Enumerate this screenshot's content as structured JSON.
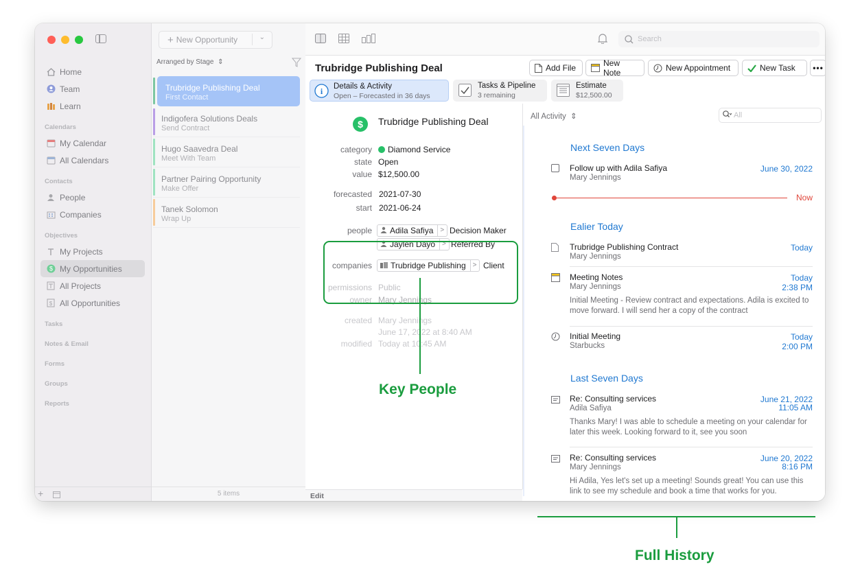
{
  "sidebar": {
    "nav": [
      {
        "label": "Home",
        "icon": "home-icon"
      },
      {
        "label": "Team",
        "icon": "team-icon"
      },
      {
        "label": "Learn",
        "icon": "learn-icon"
      }
    ],
    "sections": [
      {
        "header": "Calendars",
        "items": [
          {
            "label": "My Calendar",
            "icon": "calendar-icon"
          },
          {
            "label": "All Calendars",
            "icon": "calendars-icon"
          }
        ]
      },
      {
        "header": "Contacts",
        "items": [
          {
            "label": "People",
            "icon": "person-icon"
          },
          {
            "label": "Companies",
            "icon": "building-icon"
          }
        ]
      },
      {
        "header": "Objectives",
        "items": [
          {
            "label": "My Projects",
            "icon": "project-icon"
          },
          {
            "label": "My Opportunities",
            "icon": "opportunity-icon",
            "active": true
          },
          {
            "label": "All Projects",
            "icon": "projects-icon"
          },
          {
            "label": "All Opportunities",
            "icon": "opportunities-icon"
          }
        ]
      }
    ],
    "more_headers": [
      "Tasks",
      "Notes & Email",
      "Forms",
      "Groups",
      "Reports"
    ]
  },
  "list": {
    "new_button": "New Opportunity",
    "arranged_by": "Arranged by Stage",
    "footer": "5 items",
    "deals": [
      {
        "title": "Trubridge Publishing Deal",
        "subtitle": "First Contact",
        "color": "#7cc7a1",
        "selected": true
      },
      {
        "title": "Indigofera Solutions Deals",
        "subtitle": "Send Contract",
        "color": "#b99ee6"
      },
      {
        "title": "Hugo Saavedra Deal",
        "subtitle": "Meet With Team",
        "color": "#9fe3c1"
      },
      {
        "title": "Partner Pairing Opportunity",
        "subtitle": "Make Offer",
        "color": "#9fe3c1"
      },
      {
        "title": "Tanek Solomon",
        "subtitle": "Wrap Up",
        "color": "#f7cc9b"
      }
    ]
  },
  "toolbar": {
    "search_placeholder": "Search"
  },
  "header": {
    "title": "Trubridge Publishing Deal",
    "buttons": {
      "add_file": "Add File",
      "new_note": "New Note",
      "new_appointment": "New Appointment",
      "new_task": "New Task"
    },
    "tabs": [
      {
        "label": "Details & Activity",
        "sub": "Open – Forecasted in 36 days"
      },
      {
        "label": "Tasks & Pipeline",
        "sub": "3 remaining"
      },
      {
        "label": "Estimate",
        "sub": "$12,500.00"
      }
    ]
  },
  "details": {
    "title": "Trubridge Publishing Deal",
    "dollar": "$",
    "fields": {
      "category_label": "category",
      "category_value": "Diamond Service",
      "state_label": "state",
      "state_value": "Open",
      "value_label": "value",
      "value_value": "$12,500.00",
      "forecasted_label": "forecasted",
      "forecasted_value": "2021-07-30",
      "start_label": "start",
      "start_value": "2021-06-24",
      "people_label": "people",
      "people": [
        {
          "name": "Adila Safiya",
          "role": "Decision Maker"
        },
        {
          "name": "Jaylen Dayo",
          "role": "Referred By"
        }
      ],
      "companies_label": "companies",
      "company": {
        "name": "Trubridge Publishing",
        "role": "Client"
      },
      "permissions_label": "permissions",
      "permissions_value": "Public",
      "owner_label": "owner",
      "owner_value": "Mary Jennings",
      "created_label": "created",
      "created_by": "Mary Jennings",
      "created_at": "June 17, 2022 at 8:40 AM",
      "modified_label": "modified",
      "modified_value": "Today at 10:45 AM"
    },
    "footer": "Edit",
    "category_color": "#27c068"
  },
  "activity": {
    "filter": "All Activity",
    "search_placeholder": "All",
    "now_label": "Now",
    "sections": {
      "next": "Next Seven Days",
      "earlier": "Ealier Today",
      "last": "Last Seven Days"
    },
    "items": [
      {
        "title": "Follow up with Adila Safiya",
        "sub": "Mary Jennings",
        "date": "June 30, 2022",
        "icon": "checkbox-icon"
      },
      {
        "title": "Trubridge Publishing Contract",
        "sub": "Mary Jennings",
        "date": "Today",
        "icon": "document-icon"
      },
      {
        "title": "Meeting Notes",
        "sub": "Mary Jennings",
        "date": "Today",
        "time": "2:38 PM",
        "body": "Initial Meeting - Review contract and expectations. Adila is excited to move forward. I will send her a copy of the contract",
        "icon": "note-icon"
      },
      {
        "title": "Initial Meeting",
        "sub": "Starbucks",
        "date": "Today",
        "time": "2:00 PM",
        "icon": "clock-icon"
      },
      {
        "title": "Re: Consulting services",
        "sub": "Adila Safiya",
        "date": "June 21, 2022",
        "time": "11:05 AM",
        "body": "Thanks Mary! I was able to schedule a meeting on your calendar for later this week. Looking forward to it, see you soon",
        "icon": "email-icon"
      },
      {
        "title": "Re: Consulting services",
        "sub": "Mary Jennings",
        "date": "June 20, 2022",
        "time": "8:16 PM",
        "body": "Hi Adila, Yes let's set up a meeting! Sounds great! You can use this link to see my schedule and book a time that works for you.",
        "icon": "email-icon"
      }
    ]
  },
  "callouts": {
    "key_people": "Key People",
    "full_history": "Full History"
  },
  "colors": {
    "accent": "#1f78d1",
    "callout": "#1a9c3e",
    "now": "#e0453a",
    "selection": "#a5c4f7"
  }
}
